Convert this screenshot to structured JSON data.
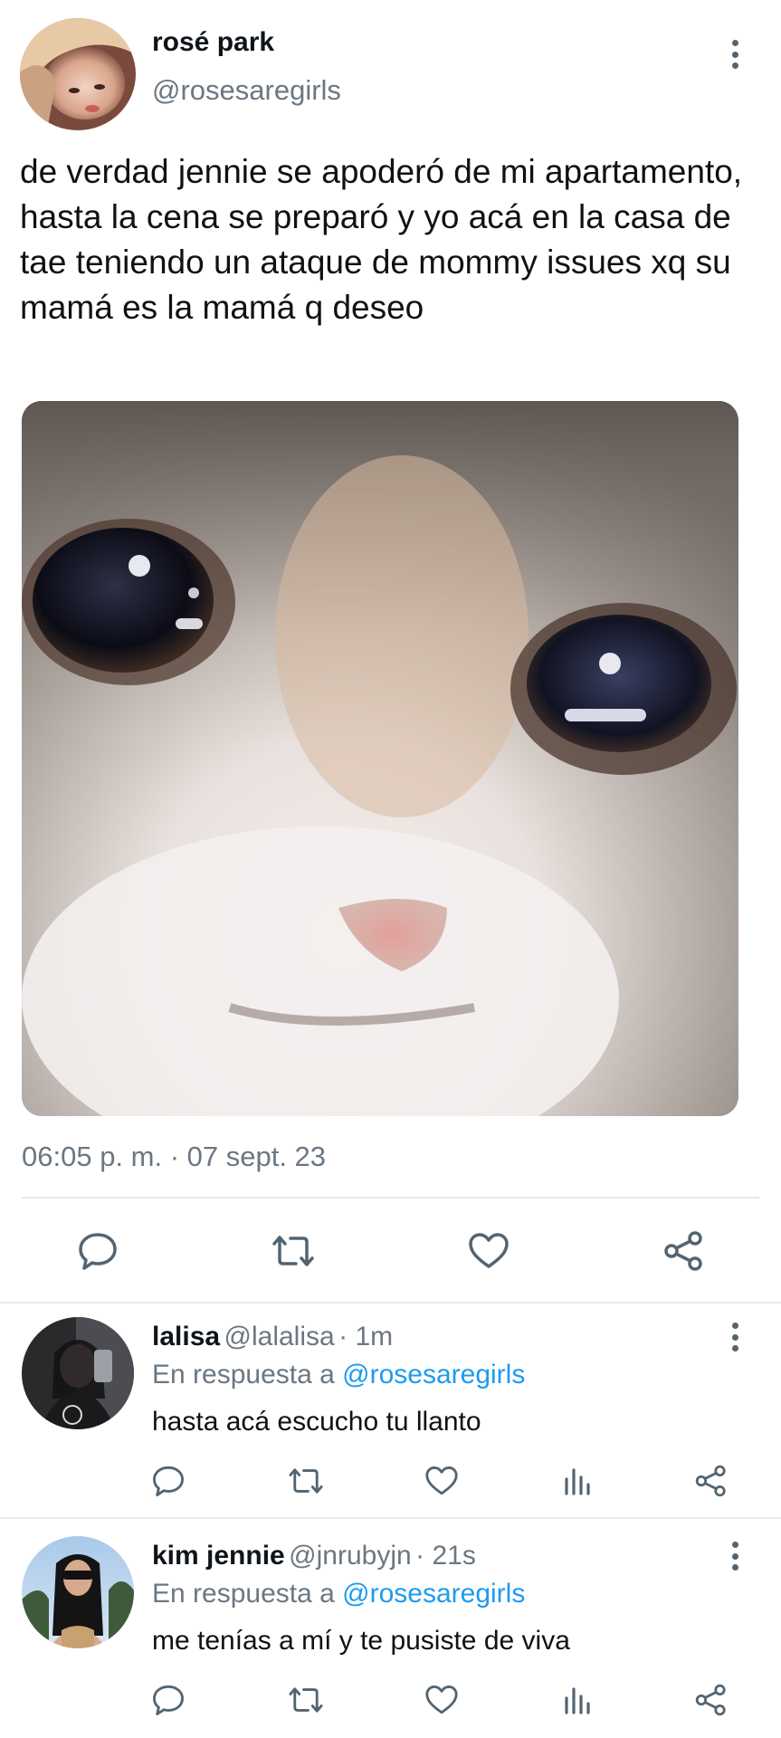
{
  "tweet": {
    "display_name": "rosé park",
    "handle": "@rosesaregirls",
    "text": "de verdad jennie se apoderó de mi apartamento, hasta la cena se preparó y yo acá en la casa de tae teniendo un ataque de mommy issues xq su mamá es la mamá q deseo",
    "timestamp": "06:05 p. m. · 07 sept. 23",
    "media_alt": "crying cat face",
    "actions": [
      "reply-icon",
      "retweet-icon",
      "like-icon",
      "share-icon"
    ]
  },
  "replies": [
    {
      "display_name": "lalisa",
      "handle": "@lalalisa",
      "time": "· 1m",
      "reply_prefix": "En respuesta a",
      "reply_to": "@rosesaregirls",
      "text": "hasta acá escucho tu llanto"
    },
    {
      "display_name": "kim jennie",
      "handle": "@jnrubyjn",
      "time": "· 21s",
      "reply_prefix": "En respuesta a",
      "reply_to": "@rosesaregirls",
      "text": "me tenías a mí y te pusiste de viva"
    }
  ],
  "colors": {
    "link": "#1d9bf0",
    "secondary_text": "#6b7782",
    "icon": "#536471",
    "divider": "#e6e9eb"
  }
}
